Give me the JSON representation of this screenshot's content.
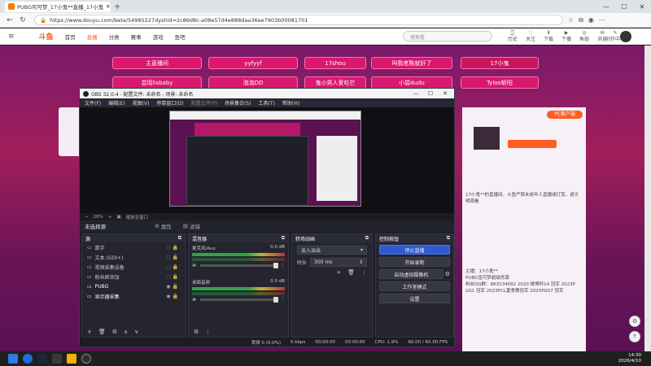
{
  "browser": {
    "tab_title": "PUBG可可梦_17小鬼**直播_17小鬼",
    "url": "https://www.douyu.com/beta/54985227dyshid=2c86d8c-a08e57d4e888daa36ee7903b00081701"
  },
  "site": {
    "logo": "斗鱼",
    "nav": [
      "首页",
      "直播",
      "分类",
      "赛事",
      "游戏",
      "鱼吧"
    ],
    "search_placeholder": "搜索看",
    "header_icons": [
      "历史",
      "关注",
      "下载",
      "下播",
      "鱼翅",
      "消息",
      "创作中心"
    ]
  },
  "gifts_row1": [
    "主直播间",
    "yyfyyf",
    "17shou",
    "叫我老陈就好了",
    "17小鬼"
  ],
  "gifts_row2": [
    "芸瑶lisbaby",
    "泡泡DD",
    "鬼小男人爱吃芒",
    "小碧dudu",
    "Tyloo斩阳"
  ],
  "obs": {
    "title": "OBS 32.0.4 - 配置文件: 未命名 - 场景: 未命名",
    "menu": [
      "文件(F)",
      "编辑(E)",
      "视图(V)",
      "停靠窗口(D)",
      "配置文件(P)",
      "场景集合(S)",
      "工具(T)",
      "帮助(H)"
    ],
    "zoom": "26%",
    "zoom_label": "缩放至窗口",
    "scene_name": "未选择源",
    "scene_btn1": "属性",
    "scene_btn2": "滤镜",
    "sources_title": "源",
    "sources": [
      "数字",
      "文本 (GDI+)",
      "视频采集设备",
      "粉丝群添加",
      "PUBG",
      "显示器采集"
    ],
    "mixer_title": "混音器",
    "mixer": [
      {
        "name": "麦克风/Aux",
        "db": "0.0 dB"
      },
      {
        "name": "桌面音频",
        "db": "0.0 dB"
      }
    ],
    "transition_title": "转场动画",
    "transition_type": "淡入淡出",
    "duration_label": "时长",
    "duration_value": "300 ms",
    "controls_title": "控制按钮",
    "controls": [
      "停止直播",
      "开始录制",
      "启动虚拟摄像机",
      "工作室模式",
      "设置"
    ],
    "status": {
      "dropped": "丢帧 0 (0.0%)",
      "bitrate": "0 kbps",
      "live_time": "00:00:00",
      "rec_time": "00:00:00",
      "cpu": "CPU: 1.9%",
      "fps": "60.00 / 60.00 FPS"
    }
  },
  "chat": {
    "pc_label": "PC客户端",
    "lines": [
      "17小鬼**的直播间。斗鱼严禁未成年人直播或打赏，请文明观看",
      "PUBG宝可梦超级房源",
      "粉丝QQ群：863134092  2020 微博杯14 冠军 2023P GS1 冠军 2023PCL夏季赛冠军 2025PGS7 冠军"
    ],
    "owner_label": "主播：17小鬼**"
  },
  "taskbar": {
    "time": "14:30",
    "date": "2026/4/10"
  }
}
